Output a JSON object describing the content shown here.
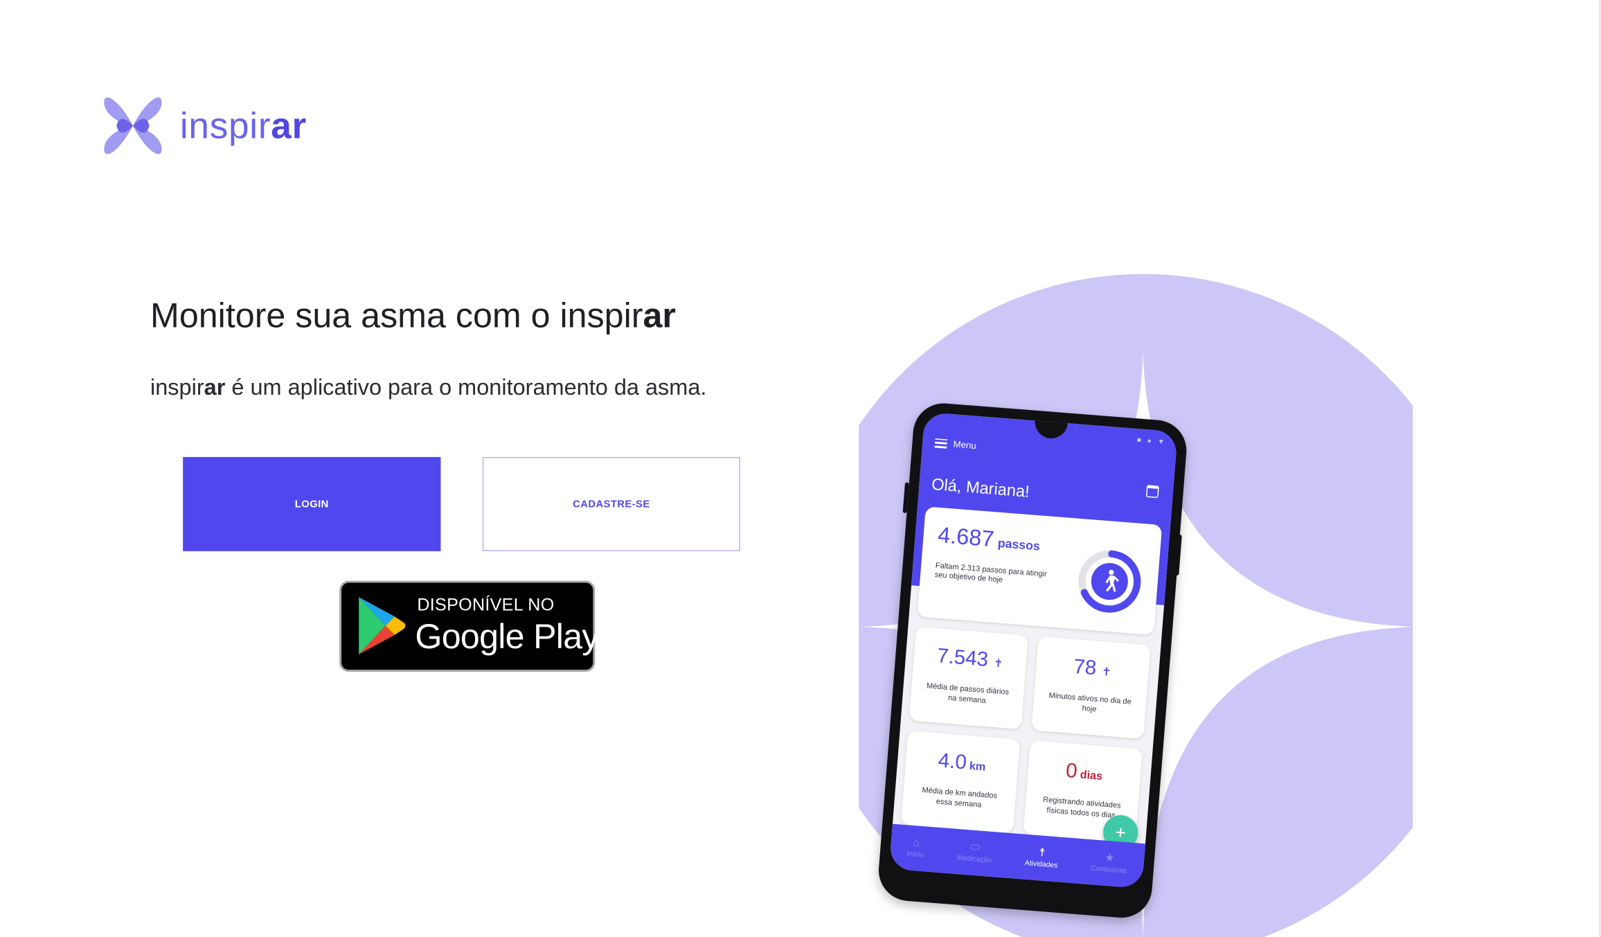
{
  "brand": {
    "name_light": "inspir",
    "name_bold": "ar"
  },
  "hero": {
    "title_prefix": "Monitore sua asma com o inspir",
    "title_bold": "ar",
    "subtitle_brand_light": "inspir",
    "subtitle_brand_bold": "ar",
    "subtitle_rest": " é um aplicativo para o monitoramento da asma."
  },
  "actions": {
    "login_label": "LOGIN",
    "signup_label": "CADASTRE-SE"
  },
  "store_badge": {
    "small_text": "DISPONÍVEL NO",
    "big_text": "Google Play"
  },
  "phone_app": {
    "menu_label": "Menu",
    "greeting": "Olá, Mariana!",
    "steps": {
      "value": "4.687",
      "unit": "passos",
      "note": "Faltam 2.313 passos para atingir seu objetivo de hoje",
      "progress_fraction": 0.67
    },
    "cards": [
      {
        "value": "7.543",
        "unit": "",
        "label": "Média de passos diários na semana"
      },
      {
        "value": "78",
        "unit": "",
        "label": "Minutos ativos no dia de hoje"
      },
      {
        "value": "4.0",
        "unit": "km",
        "label": "Média de km andados essa semana"
      },
      {
        "value": "0",
        "unit": "dias",
        "label": "Registrando atividades físicas todos os dias"
      }
    ],
    "fab_label": "+",
    "nav": [
      {
        "label": "Início",
        "icon": "home-icon"
      },
      {
        "label": "Medicação",
        "icon": "pill-icon"
      },
      {
        "label": "Atividades",
        "icon": "person-icon"
      },
      {
        "label": "Conquistas",
        "icon": "star-icon"
      }
    ]
  },
  "colors": {
    "primary": "#5048ee",
    "brand_light": "#6a63ea",
    "deco_lavender": "#cdc7f7",
    "logo_petal": "#8f86ee",
    "fab": "#3fc9a6",
    "alert_red": "#c0223a"
  }
}
